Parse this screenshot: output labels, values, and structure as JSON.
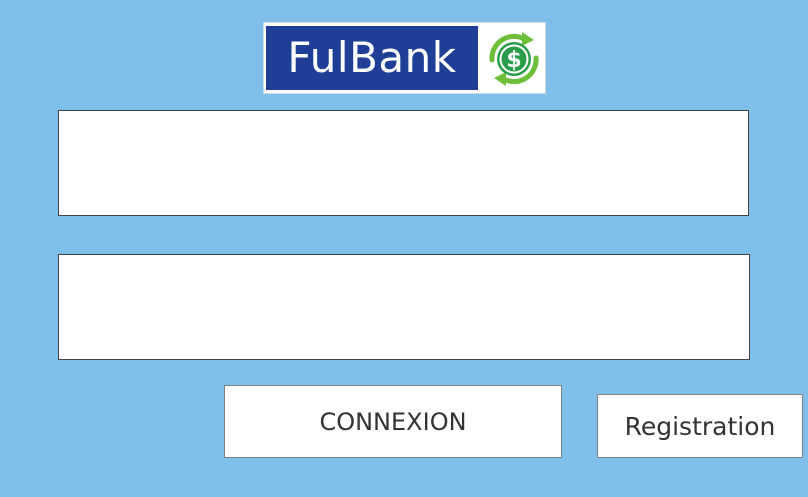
{
  "logo": {
    "text": "FulBank",
    "icon": "dollar-exchange-icon",
    "colors": {
      "brand_blue": "#1f3f97",
      "icon_green": "#2a9d4a",
      "icon_green_light": "#6dbf3a"
    }
  },
  "form": {
    "username_value": "",
    "password_value": ""
  },
  "buttons": {
    "connexion_label": "CONNEXION",
    "registration_label": "Registration"
  },
  "colors": {
    "background": "#7fbfea",
    "field_border": "#444444",
    "button_text": "#333333"
  }
}
